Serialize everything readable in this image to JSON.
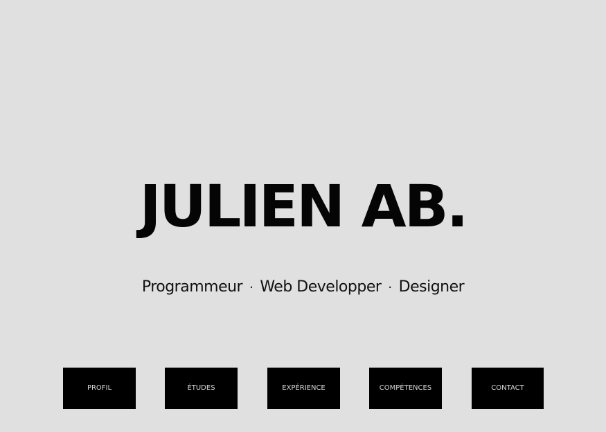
{
  "hero": {
    "name": "JULIEN AB.",
    "roles": [
      "Programmeur",
      "Web Developper",
      "Designer"
    ],
    "separator": "·"
  },
  "nav": {
    "items": [
      {
        "label": "PROFIL"
      },
      {
        "label": "ÉTUDES"
      },
      {
        "label": "EXPÉRIENCE"
      },
      {
        "label": "COMPÉTENCES"
      },
      {
        "label": "CONTACT"
      }
    ]
  },
  "colors": {
    "background": "#e0e0e0",
    "button_bg": "#000000",
    "button_text": "#d8d8d8",
    "title": "#050505"
  }
}
